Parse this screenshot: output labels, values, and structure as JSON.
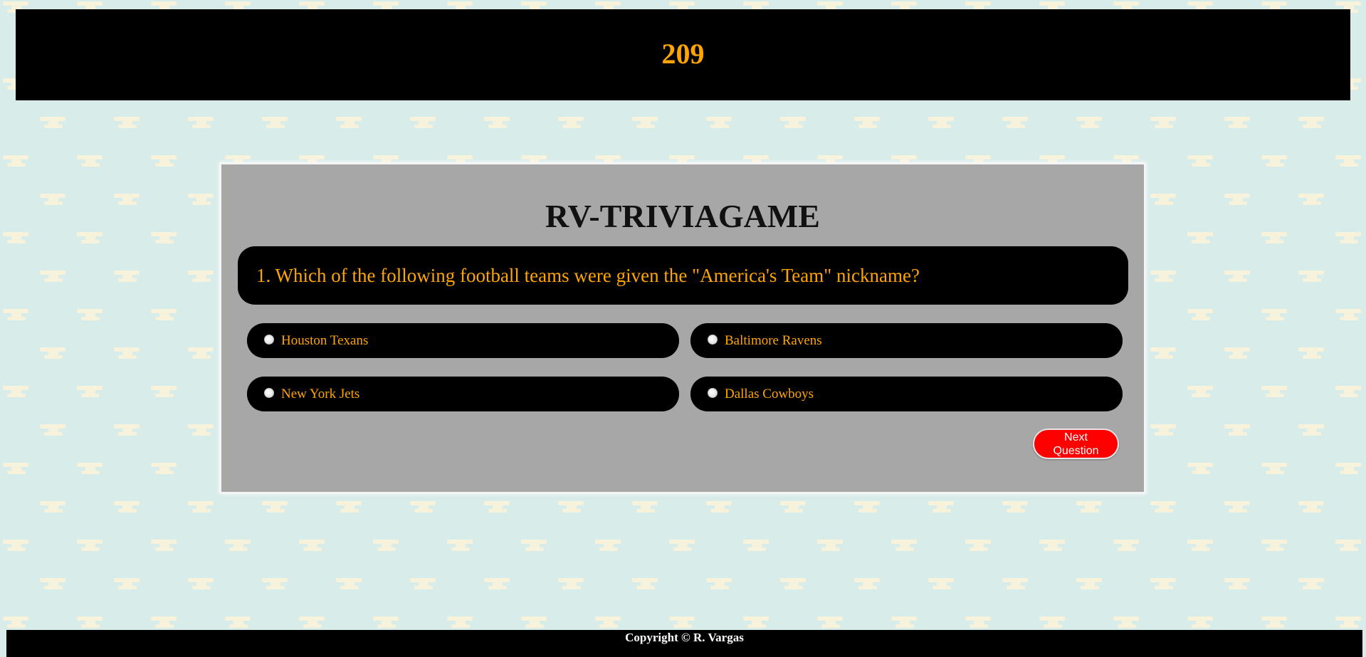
{
  "timer": {
    "value": "209"
  },
  "game": {
    "title": "RV-TRIVIAGAME",
    "question": "1. Which of the following football teams were given the \"America's Team\" nickname?",
    "answers": [
      {
        "label": "Houston Texans",
        "selected": false
      },
      {
        "label": "Baltimore Ravens",
        "selected": false
      },
      {
        "label": "New York Jets",
        "selected": false
      },
      {
        "label": "Dallas Cowboys",
        "selected": false
      }
    ],
    "next_button_label": "Next\nQuestion"
  },
  "footer": {
    "copyright": "Copyright © R. Vargas"
  },
  "colors": {
    "background": "#d8ecea",
    "pattern": "#f6f2dc",
    "accent_text": "#ffa500",
    "panel": "#a7a7a7",
    "button": "#ff0000"
  }
}
